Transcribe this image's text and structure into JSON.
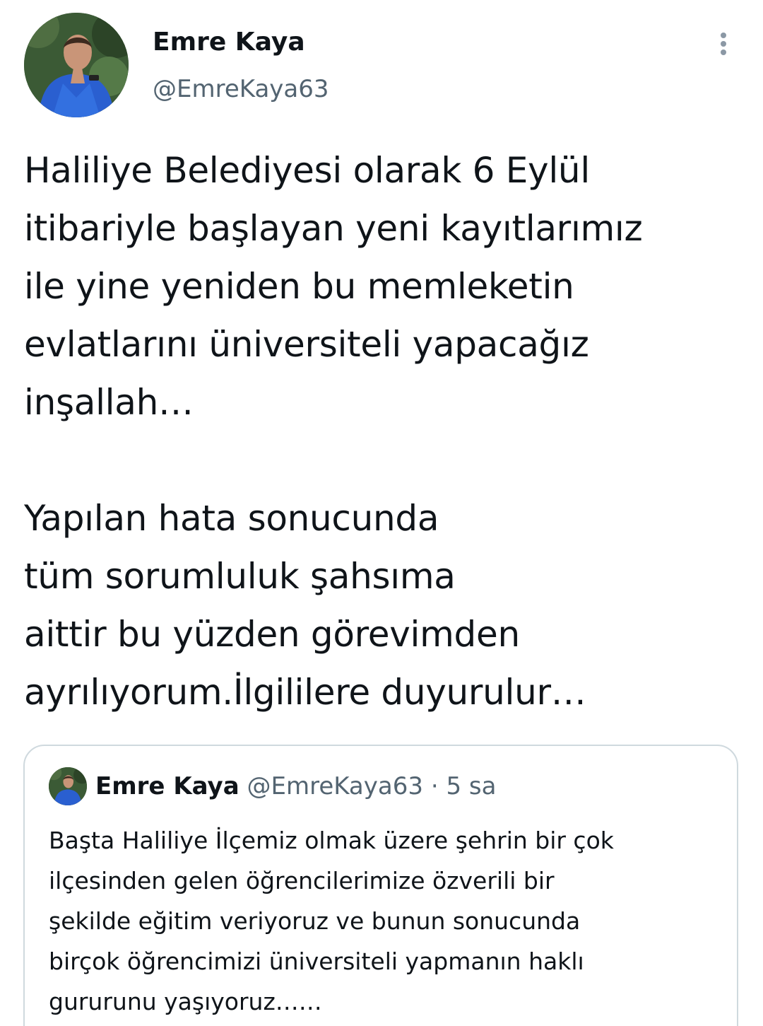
{
  "tweet": {
    "author": {
      "name": "Emre Kaya",
      "handle": "@EmreKaya63",
      "avatar_icon": "profile-photo"
    },
    "more_icon": "vertical-ellipsis-icon",
    "text": "Haliliye Belediyesi olarak 6 Eylül\nitibariyle başlayan yeni kayıtlarımız\nile yine yeniden bu memleketin\nevlatlarını üniversiteli yapacağız\ninşallah…\n\nYapılan hata sonucunda\ntüm sorumluluk şahsıma\naittir bu yüzden görevimden\nayrılıyorum.İlgililere duyurulur…"
  },
  "quoted_tweet": {
    "author": {
      "name": "Emre Kaya",
      "handle": "@EmreKaya63",
      "avatar_icon": "profile-photo"
    },
    "separator": "·",
    "time": "5 sa",
    "text": "Başta Haliliye İlçemiz olmak üzere şehrin bir çok\nilçesinden gelen öğrencilerimize özverili bir\nşekilde eğitim veriyoruz ve bunun sonucunda\nbirçok öğrencimizi üniversiteli yapmanın haklı\ngururunu yaşıyoruz……"
  },
  "colors": {
    "text_primary": "#0f1419",
    "text_secondary": "#536471",
    "border": "#cfd9de",
    "icon_gray": "#8b98a5"
  }
}
